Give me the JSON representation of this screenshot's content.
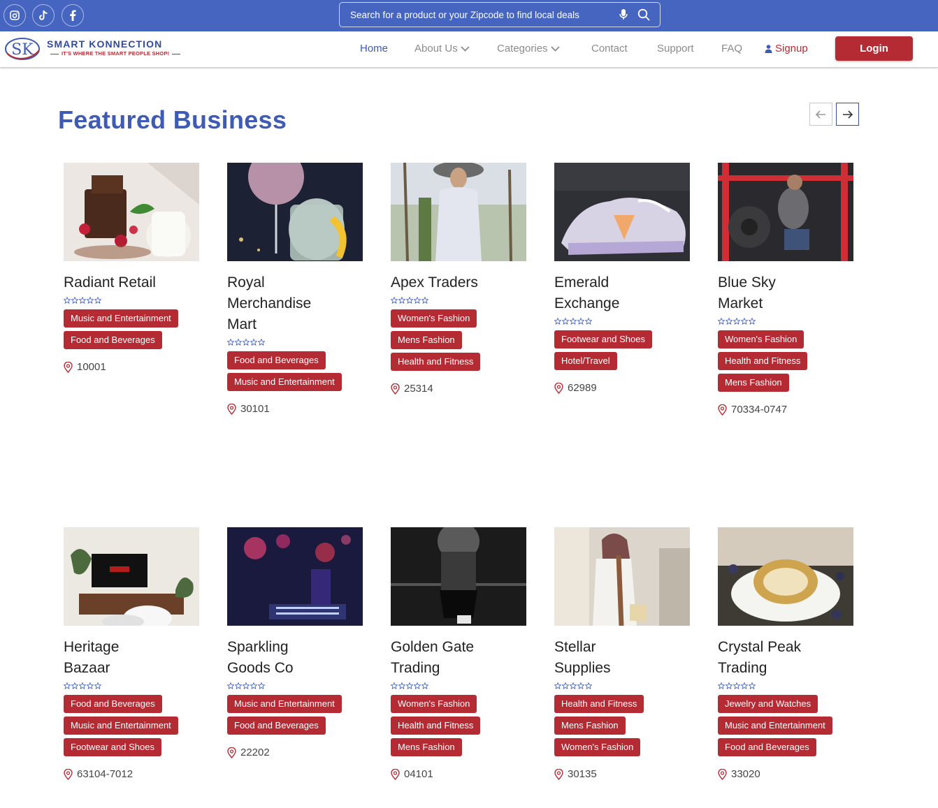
{
  "topbar": {
    "social": [
      {
        "name": "instagram-icon"
      },
      {
        "name": "tiktok-icon"
      },
      {
        "name": "facebook-icon"
      }
    ],
    "search_placeholder": "Search for a product or your Zipcode to find local deals"
  },
  "brand": {
    "logo_letters": "SK",
    "title": "SMART KONNECTION",
    "tagline": "IT'S WHERE THE SMART PEOPLE SHOP!"
  },
  "nav": {
    "home": "Home",
    "about": "About Us",
    "categories": "Categories",
    "contact": "Contact",
    "support": "Support",
    "faq": "FAQ",
    "signup": "Signup",
    "login": "Login"
  },
  "section": {
    "title": "Featured Business"
  },
  "colors": {
    "topbar": "#4565c0",
    "brand_blue": "#3e5bb5",
    "accent_red": "#b52b34"
  },
  "businesses": [
    {
      "name": "Radiant Retail",
      "rating": 0,
      "tags": [
        "Music and Entertainment",
        "Food and Beverages"
      ],
      "zip": "10001"
    },
    {
      "name": "Royal Merchandise Mart",
      "rating": 0,
      "tags": [
        "Food and Beverages",
        "Music and Entertainment"
      ],
      "zip": "30101"
    },
    {
      "name": "Apex Traders",
      "rating": 0,
      "tags": [
        "Women's Fashion",
        "Mens Fashion",
        "Health and Fitness"
      ],
      "zip": "25314"
    },
    {
      "name": "Emerald Exchange",
      "rating": 0,
      "tags": [
        "Footwear and Shoes",
        "Hotel/Travel"
      ],
      "zip": "62989"
    },
    {
      "name": "Blue Sky Market",
      "rating": 0,
      "tags": [
        "Women's Fashion",
        "Health and Fitness",
        "Mens Fashion"
      ],
      "zip": "70334-0747"
    },
    {
      "name": "Heritage Bazaar",
      "rating": 0,
      "tags": [
        "Food and Beverages",
        "Music and Entertainment",
        "Footwear and Shoes"
      ],
      "zip": "63104-7012"
    },
    {
      "name": "Sparkling Goods Co",
      "rating": 0,
      "tags": [
        "Music and Entertainment",
        "Food and Beverages"
      ],
      "zip": "22202"
    },
    {
      "name": "Golden Gate Trading",
      "rating": 0,
      "tags": [
        "Women's Fashion",
        "Health and Fitness",
        "Mens Fashion"
      ],
      "zip": "04101"
    },
    {
      "name": "Stellar Supplies",
      "rating": 0,
      "tags": [
        "Health and Fitness",
        "Mens Fashion",
        "Women's Fashion"
      ],
      "zip": "30135"
    },
    {
      "name": "Crystal Peak Trading",
      "rating": 0,
      "tags": [
        "Jewelry and Watches",
        "Music and Entertainment",
        "Food and Beverages"
      ],
      "zip": "33020"
    }
  ]
}
